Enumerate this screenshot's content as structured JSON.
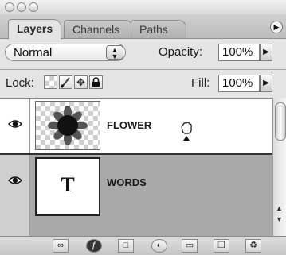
{
  "tabs": [
    {
      "label": "Layers",
      "active": true
    },
    {
      "label": "Channels",
      "active": false
    },
    {
      "label": "Paths",
      "active": false
    }
  ],
  "blend_mode": {
    "value": "Normal"
  },
  "opacity": {
    "label": "Opacity:",
    "value": "100%"
  },
  "lock": {
    "label": "Lock:"
  },
  "fill": {
    "label": "Fill:",
    "value": "100%"
  },
  "layers": [
    {
      "name": "FLOWER",
      "visible": true,
      "thumbnail": "flower-on-transparency"
    },
    {
      "name": "WORDS",
      "visible": true,
      "thumbnail": "type-layer",
      "thumb_glyph": "T"
    }
  ],
  "icons": {
    "lock_transparent": "checkerboard-lock-icon",
    "lock_image": "brush-lock-icon",
    "lock_position": "move-lock-icon",
    "lock_all": "padlock-icon",
    "eye": "eye-icon",
    "cursor": "grab-hand-cursor-icon"
  },
  "colors": {
    "panel_bg": "#e4e4e4",
    "list_bg": "#ffffff",
    "selected_row_bg": "#a9a9a9"
  }
}
